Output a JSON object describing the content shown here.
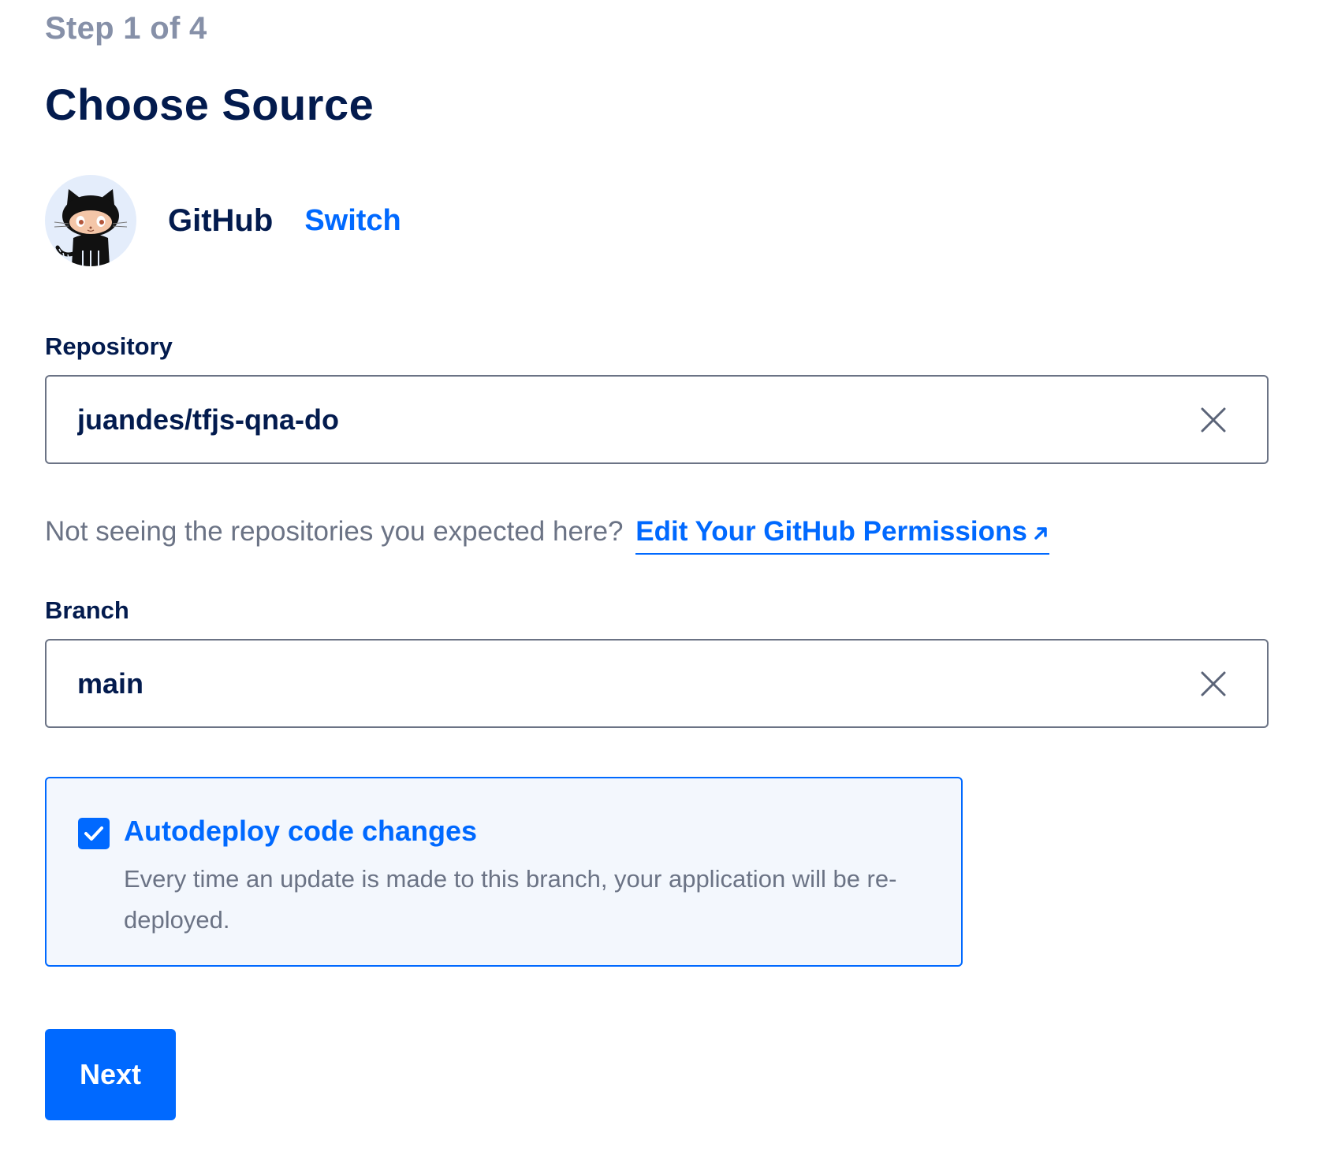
{
  "header": {
    "step": "Step 1 of 4",
    "title": "Choose Source"
  },
  "provider": {
    "name": "GitHub",
    "switch_label": "Switch",
    "avatar_icon": "github-octocat-icon"
  },
  "repository": {
    "label": "Repository",
    "value": "juandes/tfjs-qna-do",
    "clear_icon": "close-icon"
  },
  "hint": {
    "text": "Not seeing the repositories you expected here?",
    "link_label": "Edit Your GitHub Permissions",
    "link_icon": "external-link-arrow-icon"
  },
  "branch": {
    "label": "Branch",
    "value": "main",
    "clear_icon": "close-icon"
  },
  "autodeploy": {
    "checked": true,
    "title": "Autodeploy code changes",
    "description": "Every time an update is made to this branch, your application will be re-deployed."
  },
  "actions": {
    "next_label": "Next"
  },
  "colors": {
    "accent": "#0069ff",
    "text_dark": "#031b4e",
    "text_muted": "#6b7385",
    "panel_bg": "#f3f7fd"
  }
}
